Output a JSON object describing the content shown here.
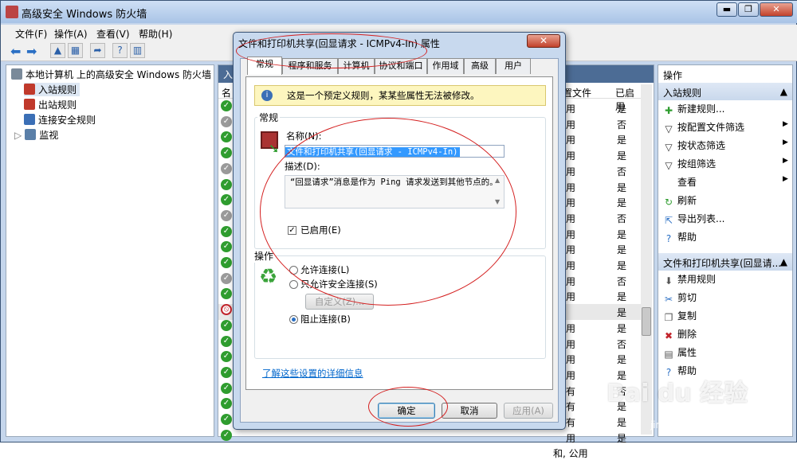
{
  "window": {
    "title": "高级安全 Windows 防火墙",
    "min": "▬",
    "max": "❐",
    "close": "✕"
  },
  "menu": [
    "文件(F)",
    "操作(A)",
    "查看(V)",
    "帮助(H)"
  ],
  "tree": {
    "root": "本地计算机 上的高级安全 Windows 防火墙",
    "items": [
      "入站规则",
      "出站规则",
      "连接安全规则",
      "监视"
    ]
  },
  "list": {
    "header_name": "入",
    "col_name": "名",
    "col_config": "置文件",
    "col_enabled": "已启用",
    "rows": [
      {
        "icon": "allow",
        "cfg": "用",
        "en": "是"
      },
      {
        "icon": "disabled",
        "cfg": "用",
        "en": "否"
      },
      {
        "icon": "allow",
        "cfg": "用",
        "en": "是"
      },
      {
        "icon": "allow",
        "cfg": "用",
        "en": "是"
      },
      {
        "icon": "disabled",
        "cfg": "用",
        "en": "否"
      },
      {
        "icon": "allow",
        "cfg": "用",
        "en": "是"
      },
      {
        "icon": "allow",
        "cfg": "用",
        "en": "是"
      },
      {
        "icon": "disabled",
        "cfg": "用",
        "en": "否"
      },
      {
        "icon": "allow",
        "cfg": "用",
        "en": "是"
      },
      {
        "icon": "allow",
        "cfg": "用",
        "en": "是"
      },
      {
        "icon": "allow",
        "cfg": "用",
        "en": "是"
      },
      {
        "icon": "disabled",
        "cfg": "用",
        "en": "否"
      },
      {
        "icon": "allow",
        "cfg": "用",
        "en": "是"
      },
      {
        "icon": "block",
        "cfg": "",
        "en": "是"
      },
      {
        "icon": "allow",
        "cfg": "用",
        "en": "是"
      },
      {
        "icon": "allow",
        "cfg": "用",
        "en": "否"
      },
      {
        "icon": "allow",
        "cfg": "用",
        "en": "是"
      },
      {
        "icon": "allow",
        "cfg": "用",
        "en": "是"
      },
      {
        "icon": "allow",
        "cfg": "有",
        "en": "否"
      },
      {
        "icon": "allow",
        "cfg": "有",
        "en": "是"
      },
      {
        "icon": "allow",
        "cfg": "有",
        "en": "是"
      },
      {
        "icon": "allow",
        "cfg": "用",
        "en": "是"
      }
    ],
    "last_cfg": "和, 公用"
  },
  "actions": {
    "title": "操作",
    "sec1": "入站规则",
    "items1": [
      "新建规则...",
      "按配置文件筛选",
      "按状态筛选",
      "按组筛选",
      "查看",
      "刷新",
      "导出列表...",
      "帮助"
    ],
    "sec2": "文件和打印机共享(回显请...",
    "items2": [
      "禁用规则",
      "剪切",
      "复制",
      "删除",
      "属性",
      "帮助"
    ]
  },
  "dialog": {
    "title": "文件和打印机共享(回显请求 - ICMPv4-In) 属性",
    "close": "✕",
    "tabs": [
      "常规",
      "程序和服务",
      "计算机",
      "协议和端口",
      "作用域",
      "高级",
      "用户"
    ],
    "info": "这是一个预定义规则，某某些属性无法被修改。",
    "general_group": "常规",
    "name_label": "名称(N):",
    "name_value": "文件和打印机共享(回显请求 - ICMPv4-In)",
    "desc_label": "描述(D):",
    "desc_value": "“回显请求”消息是作为 Ping 请求发送到其他节点的。",
    "enabled_label": "已启用(E)",
    "action_group": "操作",
    "allow": "允许连接(L)",
    "allow_secure": "只允许安全连接(S)",
    "custom": "自定义(Z)...",
    "block": "阻止连接(B)",
    "link": "了解这些设置的详细信息",
    "ok": "确定",
    "cancel": "取消",
    "apply": "应用(A)"
  },
  "watermark": {
    "brand": "Bai du 经验",
    "url": "jingyan.baidu.com"
  }
}
